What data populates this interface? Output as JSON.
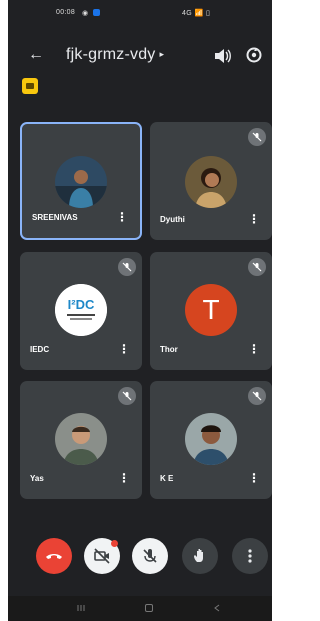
{
  "status_bar": {
    "time": "00:08",
    "right_icons": "4G 📶 ▯"
  },
  "meeting": {
    "code": "fjk-grmz-vdy"
  },
  "participants": [
    {
      "name": "SREENIVAS",
      "avatar": "photo-avatar",
      "active": true,
      "muted": false
    },
    {
      "name": "Dyuthi",
      "avatar": "photo-avatar",
      "active": false,
      "muted": true
    },
    {
      "name": "IEDC",
      "avatar": "logo-avatar",
      "logo_text": "I²DC",
      "active": false,
      "muted": true
    },
    {
      "name": "Thor",
      "avatar": "letter-avatar",
      "letter": "T",
      "active": false,
      "muted": true
    },
    {
      "name": "Yas",
      "avatar": "photo-avatar",
      "active": false,
      "muted": true
    },
    {
      "name": "K E",
      "avatar": "photo-avatar",
      "active": false,
      "muted": true
    }
  ],
  "tile_menu_glyph": "⋮",
  "controls": {
    "end_call": "end-call",
    "camera": "camera-off",
    "mic": "mic-off",
    "raise_hand": "raise-hand",
    "more": "more-options"
  }
}
